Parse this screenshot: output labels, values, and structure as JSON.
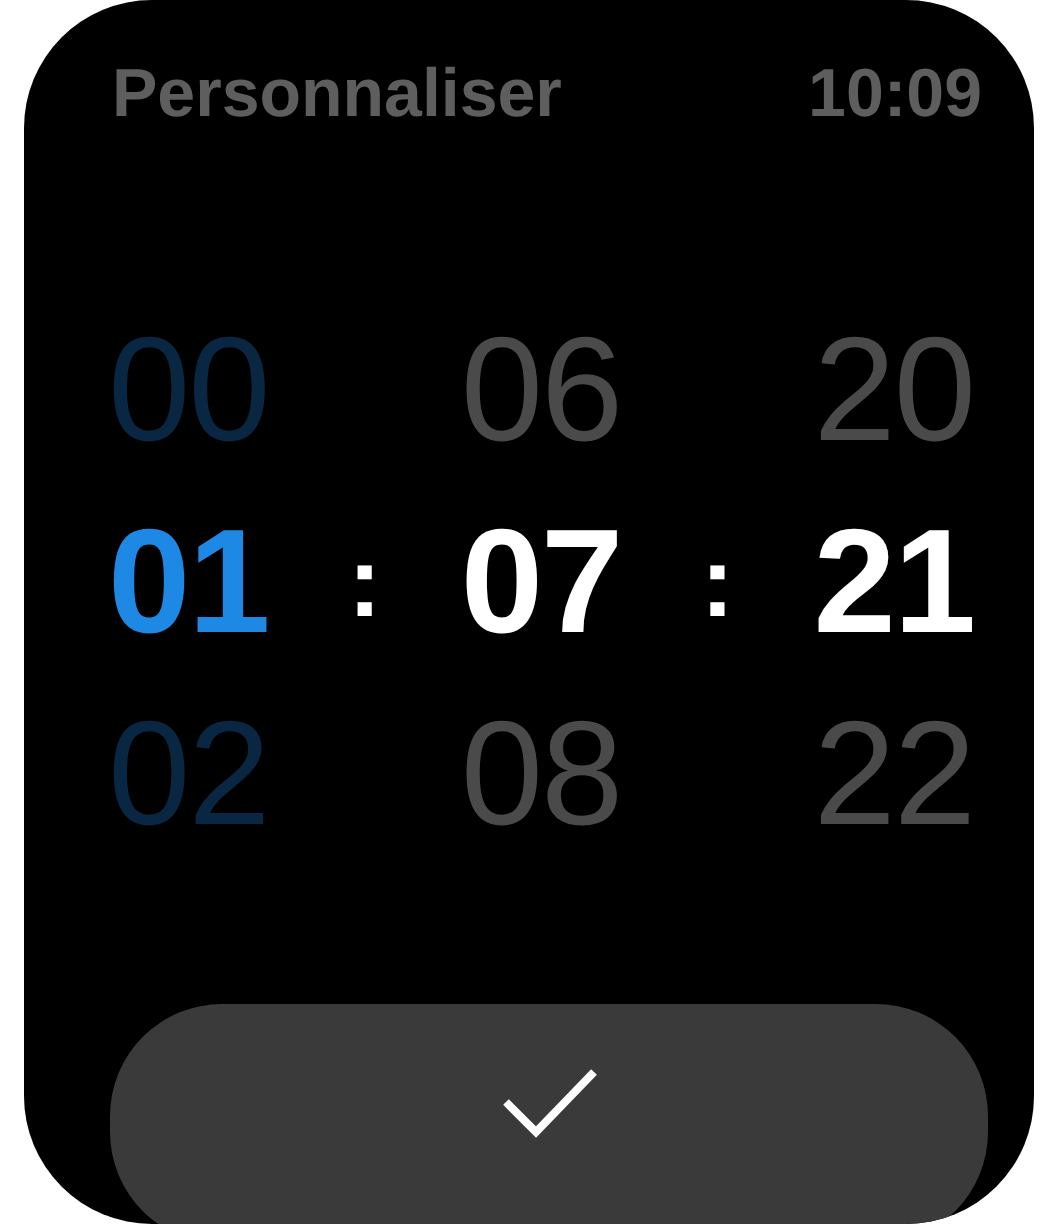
{
  "header": {
    "title": "Personnaliser",
    "time": "10:09"
  },
  "columns": [
    {
      "color": "#1e88e5",
      "items": [
        {
          "label": "00",
          "selected": false
        },
        {
          "label": "01",
          "selected": true
        },
        {
          "label": "02",
          "selected": false
        }
      ]
    },
    {
      "color": "#ffffff",
      "items": [
        {
          "label": "06",
          "selected": false
        },
        {
          "label": "07",
          "selected": true
        },
        {
          "label": "08",
          "selected": false
        }
      ]
    },
    {
      "color": "#ffffff",
      "items": [
        {
          "label": "20",
          "selected": false
        },
        {
          "label": "21",
          "selected": true
        },
        {
          "label": "22",
          "selected": false
        }
      ]
    }
  ],
  "separators": [
    ":",
    ":"
  ]
}
